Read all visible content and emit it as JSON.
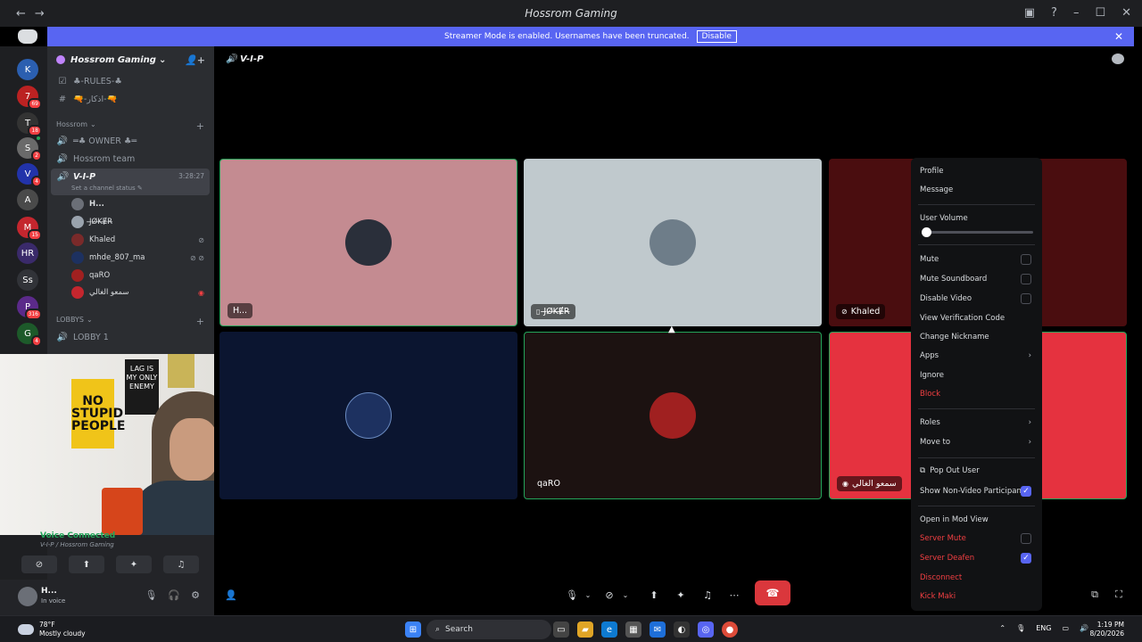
{
  "window": {
    "title": "Hossrom Gaming"
  },
  "banner": {
    "text": "Streamer Mode is enabled. Usernames have been truncated.",
    "disable_label": "Disable"
  },
  "servers": [
    {
      "label": "K",
      "badge": ""
    },
    {
      "label": "7",
      "badge": "69"
    },
    {
      "label": "T",
      "badge": "18"
    },
    {
      "label": "S",
      "badge": "2"
    },
    {
      "label": "V",
      "badge": "4"
    },
    {
      "label": "A",
      "badge": ""
    },
    {
      "label": "M",
      "badge": "15"
    },
    {
      "label": "HR",
      "badge": ""
    },
    {
      "label": "Ss",
      "badge": ""
    },
    {
      "label": "P",
      "badge": "316"
    },
    {
      "label": "G",
      "badge": "4"
    }
  ],
  "guild": {
    "name": "Hossrom Gaming"
  },
  "channels": {
    "rules": "♣-RULES-♣",
    "text2": "🔫-اذكار-🔫",
    "cat1": "Hossrom",
    "owner": "═♣ OWNER ♣═",
    "team": "Hossrom team",
    "vip": "V-I-P",
    "vip_time": "3:28:27",
    "status": "Set a channel status",
    "cat2": "LOBBYS",
    "lobby1": "LOBBY 1"
  },
  "voice_users": [
    {
      "name": "H..."
    },
    {
      "name": "J̶Ø̶K̶Ɇ̶R̶"
    },
    {
      "name": "Khaled"
    },
    {
      "name": "mhde_807_ma"
    },
    {
      "name": "qaRO"
    },
    {
      "name": "سمعو الغالي"
    }
  ],
  "voice_panel": {
    "title": "Voice Connected",
    "subtitle": "V-I-P / Hossrom Gaming"
  },
  "user": {
    "name": "H...",
    "status": "In voice"
  },
  "header": {
    "channel": "V-I-P"
  },
  "tiles": [
    {
      "name": "H...",
      "bg": "#c48b91"
    },
    {
      "name": "J̶Ø̶K̶Ɇ̶R̶",
      "bg": "#c0c9cd"
    },
    {
      "name": "Khaled",
      "bg": "#4a0d0f"
    },
    {
      "name": "mhde_807_ma",
      "bg": "#0b1530"
    },
    {
      "name": "qaRO",
      "bg": "#1c1211"
    },
    {
      "name": "سمعو الغالي",
      "bg": "#e5323f"
    }
  ],
  "menu": {
    "profile": "Profile",
    "message": "Message",
    "user_volume": "User Volume",
    "user_volume_level": 0,
    "mute": "Mute",
    "mute_soundboard": "Mute Soundboard",
    "disable_video": "Disable Video",
    "verification": "View Verification Code",
    "nickname": "Change Nickname",
    "apps": "Apps",
    "ignore": "Ignore",
    "block": "Block",
    "roles": "Roles",
    "move_to": "Move to",
    "pop_out": "Pop Out User",
    "show_nonvideo": "Show Non-Video Participants",
    "mod_view": "Open in Mod View",
    "server_mute": "Server Mute",
    "server_deafen": "Server Deafen",
    "disconnect": "Disconnect",
    "kick": "Kick Maki"
  },
  "webcam_signs": {
    "sign1": "NO STUPID PEOPLE",
    "sign2": "LAG IS MY ONLY ENEMY"
  },
  "taskbar": {
    "temp": "78°F",
    "weather": "Mostly cloudy",
    "search": "Search",
    "lang": "ENG",
    "time": "1:19 PM",
    "date": "8/20/2026"
  }
}
